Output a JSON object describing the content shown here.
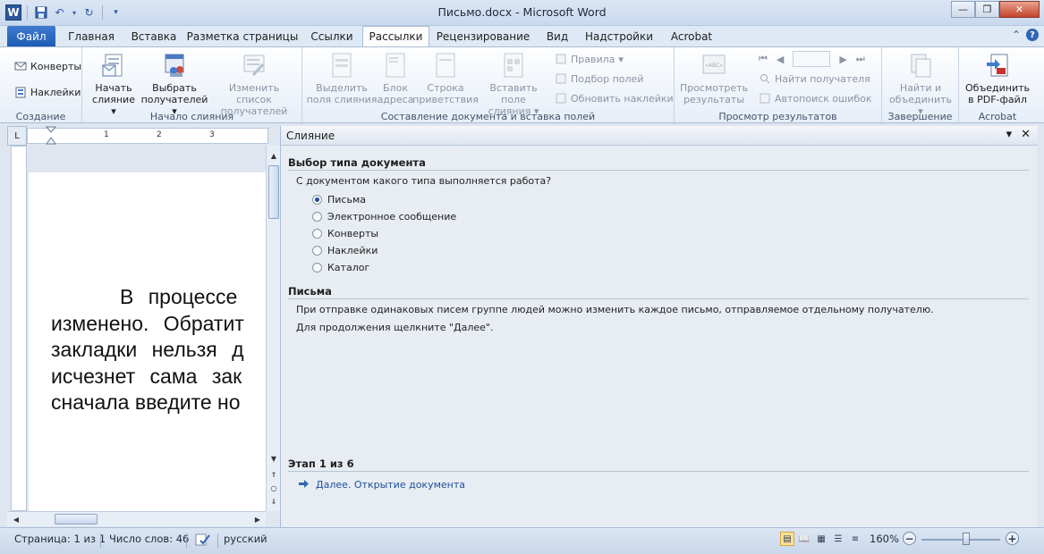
{
  "window": {
    "title": "Письмо.docx - Microsoft Word"
  },
  "qat": {
    "logo": "W"
  },
  "tabs": [
    {
      "label": "Файл"
    },
    {
      "label": "Главная"
    },
    {
      "label": "Вставка"
    },
    {
      "label": "Разметка страницы"
    },
    {
      "label": "Ссылки"
    },
    {
      "label": "Рассылки"
    },
    {
      "label": "Рецензирование"
    },
    {
      "label": "Вид"
    },
    {
      "label": "Надстройки"
    },
    {
      "label": "Acrobat"
    }
  ],
  "ribbon": {
    "create": {
      "label": "Создание",
      "envelopes": "Конверты",
      "labels": "Наклейки"
    },
    "start": {
      "label": "Начало слияния",
      "start_merge_1": "Начать",
      "start_merge_2": "слияние",
      "select_1": "Выбрать",
      "select_2": "получателей",
      "edit_1": "Изменить список",
      "edit_2": "получателей"
    },
    "fields": {
      "label": "Составление документа и вставка полей",
      "highlight_1": "Выделить",
      "highlight_2": "поля слияния",
      "address_1": "Блок",
      "address_2": "адреса",
      "greeting_1": "Строка",
      "greeting_2": "приветствия",
      "insert_1": "Вставить поле",
      "insert_2": "слияния",
      "rules": "Правила",
      "match": "Подбор полей",
      "update": "Обновить наклейки"
    },
    "preview": {
      "label": "Просмотр результатов",
      "preview_1": "Просмотреть",
      "preview_2": "результаты",
      "find": "Найти получателя",
      "auto": "Автопоиск ошибок"
    },
    "finish": {
      "label": "Завершение",
      "finish_1": "Найти и",
      "finish_2": "объединить"
    },
    "acrobat": {
      "label": "Acrobat",
      "merge_1": "Объединить",
      "merge_2": "в PDF-файл"
    }
  },
  "ruler": {
    "marks": [
      "1",
      "2",
      "3"
    ]
  },
  "document": {
    "lines": [
      "В процессе",
      "изменено. Обратит",
      "закладки нельзя д",
      "исчезнет сама зак",
      "сначала введите но"
    ]
  },
  "pane": {
    "title": "Слияние",
    "doc_type_header": "Выбор типа документа",
    "question": "С документом какого типа выполняется работа?",
    "options": [
      {
        "label": "Письма",
        "selected": true
      },
      {
        "label": "Электронное сообщение",
        "selected": false
      },
      {
        "label": "Конверты",
        "selected": false
      },
      {
        "label": "Наклейки",
        "selected": false
      },
      {
        "label": "Каталог",
        "selected": false
      }
    ],
    "letters_header": "Письма",
    "letters_desc": "При отправке одинаковых писем группе людей можно изменить каждое письмо, отправляемое отдельному получателю.",
    "continue_hint": "Для продолжения щелкните \"Далее\".",
    "step": "Этап 1 из 6",
    "next_link": "Далее. Открытие документа"
  },
  "status": {
    "page": "Страница: 1 из 1",
    "words": "Число слов: 46",
    "language": "русский",
    "zoom": "160%",
    "zoom_level_percent": 160
  }
}
